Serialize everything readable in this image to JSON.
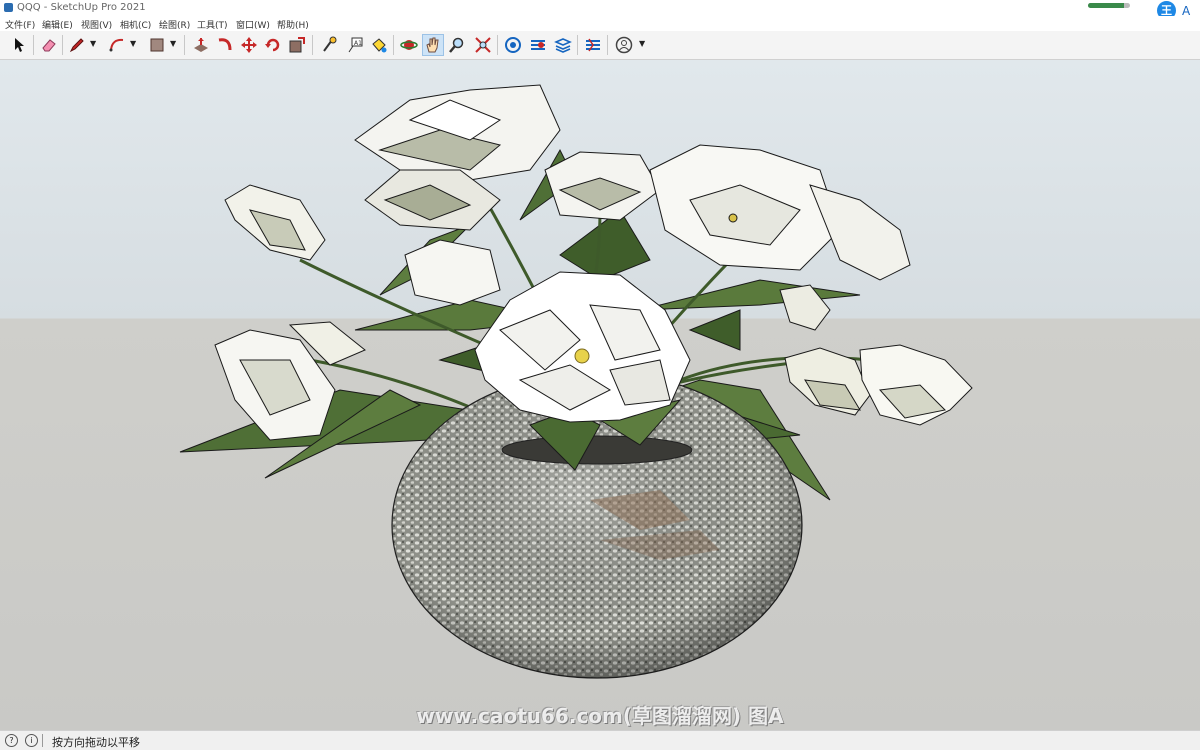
{
  "window": {
    "title": "QQQ - SketchUp Pro 2021",
    "progress": 0.85,
    "ime_badge": "王",
    "ime_letter": "A"
  },
  "menu": {
    "items": [
      "文件(F)",
      "编辑(E)",
      "视图(V)",
      "相机(C)",
      "绘图(R)",
      "工具(T)",
      "窗口(W)",
      "帮助(H)"
    ]
  },
  "toolbar": {
    "tools": [
      "select-tool",
      "eraser-tool",
      "pencil-line-tool",
      "arc-tool",
      "rectangle-tool",
      "push-pull-tool",
      "follow-me-tool",
      "move-tool",
      "rotate-tool",
      "scale-tool",
      "tape-measure-tool",
      "text-tool",
      "paint-bucket-tool",
      "orbit-tool",
      "pan-tool",
      "zoom-tool",
      "zoom-extents-tool",
      "warehouse-tool",
      "extension-warehouse-tool",
      "layout-tool",
      "extension-manager-tool",
      "account-tool"
    ],
    "active_tool": "pan-tool"
  },
  "scene": {
    "description_colors": {
      "sky": "#dbe3e7",
      "ground": "#cbcbc7",
      "petal": "#ffffff",
      "leaf": "#4f6f36",
      "vase": "#9a9a90"
    }
  },
  "watermark": "www.caotu66.com(草图溜溜网) 图A",
  "status": {
    "text": "按方向拖动以平移"
  }
}
